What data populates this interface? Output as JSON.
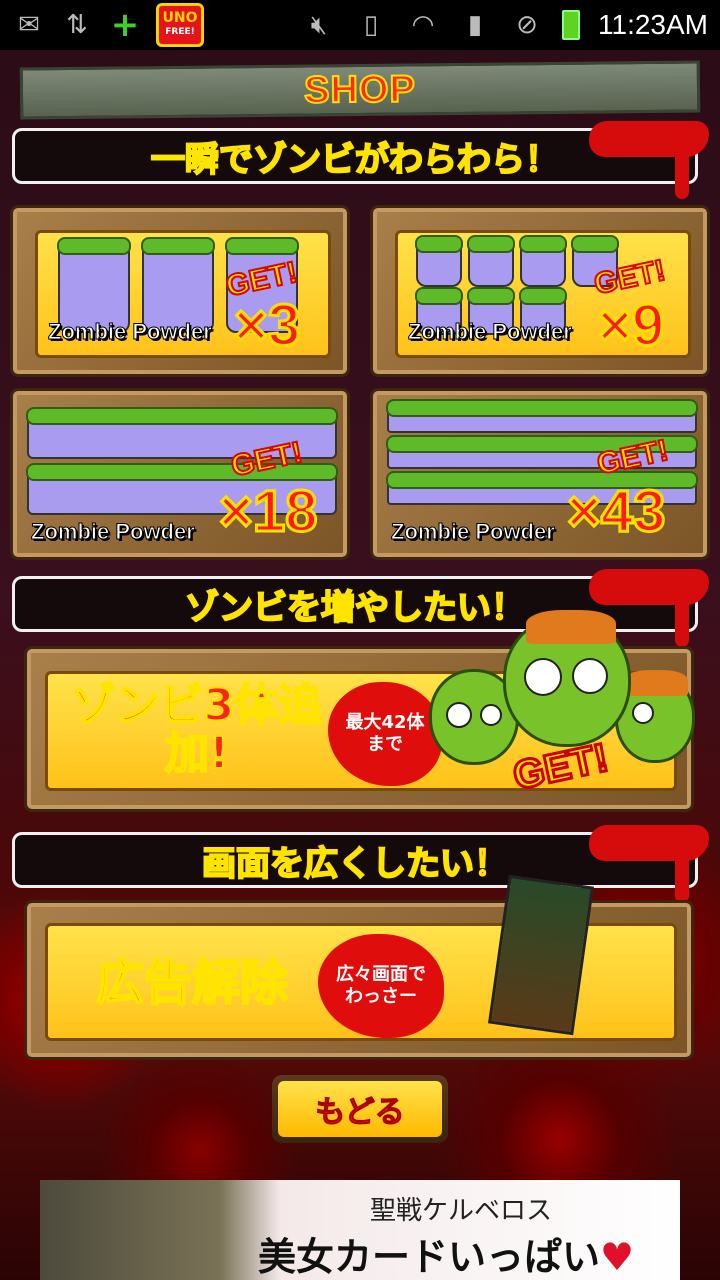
{
  "status_bar": {
    "time": "11:23AM",
    "icons": [
      "mail-icon",
      "sync-icon",
      "plus-icon",
      "uno-app-icon",
      "mute-icon",
      "vibrate-icon",
      "wifi-icon",
      "sd-card-icon",
      "block-icon",
      "battery-icon"
    ],
    "uno_top": "UNO",
    "uno_bottom": "FREE!"
  },
  "title": "SHOP",
  "sections": {
    "instant_zombies": "一瞬でゾンビがわらわら！",
    "more_zombies": "ゾンビを増やしたい！",
    "wider_screen": "画面を広くしたい！"
  },
  "powder_offers": [
    {
      "label": "Zombie Powder",
      "get": "GET!",
      "multiplier": "×3"
    },
    {
      "label": "Zombie Powder",
      "get": "GET!",
      "multiplier": "×9"
    },
    {
      "label": "Zombie Powder",
      "get": "GET!",
      "multiplier": "×18"
    },
    {
      "label": "Zombie Powder",
      "get": "GET!",
      "multiplier": "×43"
    }
  ],
  "add_zombies": {
    "title": "ゾンビ3体追加!",
    "badge": "最大42体まで",
    "get": "GET!"
  },
  "remove_ads": {
    "title": "広告解除",
    "badge": "広々画面でわっさー"
  },
  "back_button": "もどる",
  "ad_banner": {
    "subtitle": "聖戦ケルベロス",
    "headline": "美女カードいっぱい",
    "heart": "♥"
  },
  "colors": {
    "accent_red": "#ff2020",
    "accent_yellow": "#ffe100",
    "card_yellow": "#ffc21a",
    "wood": "#a97f4a"
  }
}
